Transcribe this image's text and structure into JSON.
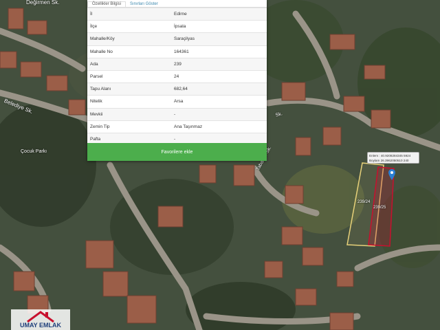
{
  "tabs": [
    "Özellikler Bilgisi",
    "Sınırları Göster"
  ],
  "parcel_rows": [
    {
      "key": "İl",
      "value": "Edirne"
    },
    {
      "key": "İlçe",
      "value": "İpsala"
    },
    {
      "key": "Mahalle/Köy",
      "value": "Saraçilyas"
    },
    {
      "key": "Mahalle No",
      "value": "164361"
    },
    {
      "key": "Ada",
      "value": "239"
    },
    {
      "key": "Parsel",
      "value": "24"
    },
    {
      "key": "Tapu Alanı",
      "value": "682,64"
    },
    {
      "key": "Nitelik",
      "value": "Arsa"
    },
    {
      "key": "Mevkii",
      "value": "-"
    },
    {
      "key": "Zemin Tip",
      "value": "Ana Taşınmaz"
    },
    {
      "key": "Pafta",
      "value": "-"
    }
  ],
  "favorite_button": "Favorilere ekle",
  "map": {
    "streets": [
      "Değirmen Sk.",
      "Belediye Sk.",
      "Çocuk Parkı",
      "Tabaklar Sk.",
      "Sk."
    ],
    "popup": {
      "line1": "Enlem : 40.9208284345 5924",
      "line2": "Boylam 26.3962050510 240"
    },
    "parcel_labels": [
      "239/24",
      "239/25"
    ],
    "parcel_color": "#c8102e",
    "parcel_outline_color": "#e8d27a"
  },
  "watermark": {
    "text": "UMAY EMLAK"
  }
}
